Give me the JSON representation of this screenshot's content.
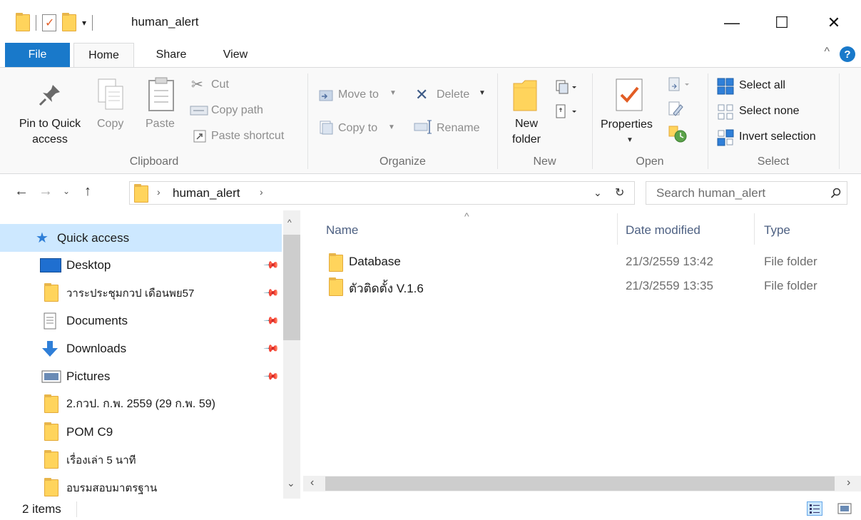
{
  "window": {
    "title": "human_alert",
    "minimize": "—",
    "maximize": "☐",
    "close": "✕"
  },
  "quick_access_toolbar": {
    "customize": "▾"
  },
  "ribbon_tabs": [
    "File",
    "Home",
    "Share",
    "View"
  ],
  "ribbon": {
    "clipboard": {
      "group": "Clipboard",
      "pin_line1": "Pin to Quick",
      "pin_line2": "access",
      "copy": "Copy",
      "paste": "Paste",
      "cut": "Cut",
      "copy_path": "Copy path",
      "paste_shortcut": "Paste shortcut"
    },
    "organize": {
      "group": "Organize",
      "move_to": "Move to",
      "copy_to": "Copy to",
      "delete": "Delete",
      "rename": "Rename"
    },
    "new": {
      "group": "New",
      "new_folder_line1": "New",
      "new_folder_line2": "folder"
    },
    "open": {
      "group": "Open",
      "properties": "Properties"
    },
    "select": {
      "group": "Select",
      "select_all": "Select all",
      "select_none": "Select none",
      "invert_selection": "Invert selection"
    }
  },
  "address": {
    "path_segment": "human_alert",
    "search_placeholder": "Search human_alert"
  },
  "nav_pane": {
    "quick_access": "Quick access",
    "items": [
      {
        "label": "Desktop",
        "icon": "desktop-icon",
        "pinned": true
      },
      {
        "label": "วาระประชุมกวป เดือนพย57",
        "icon": "folder-icon",
        "pinned": true
      },
      {
        "label": "Documents",
        "icon": "documents-icon",
        "pinned": true
      },
      {
        "label": "Downloads",
        "icon": "downloads-icon",
        "pinned": true
      },
      {
        "label": "Pictures",
        "icon": "pictures-icon",
        "pinned": true
      },
      {
        "label": "2.กวป. ก.พ. 2559 (29 ก.พ. 59)",
        "icon": "folder-icon",
        "pinned": false
      },
      {
        "label": "POM C9",
        "icon": "folder-icon",
        "pinned": false
      },
      {
        "label": "เรื่องเล่า 5 นาที",
        "icon": "folder-icon",
        "pinned": false
      },
      {
        "label": "อบรมสอบมาตรฐาน",
        "icon": "folder-icon",
        "pinned": false
      }
    ]
  },
  "file_list": {
    "columns": {
      "name": "Name",
      "date": "Date modified",
      "type": "Type"
    },
    "rows": [
      {
        "name": "Database",
        "date": "21/3/2559 13:42",
        "type": "File folder"
      },
      {
        "name": "ตัวติดตั้ง V.1.6",
        "date": "21/3/2559 13:35",
        "type": "File folder"
      }
    ]
  },
  "status": {
    "item_count": "2 items"
  },
  "colors": {
    "accent": "#1979ca",
    "selection": "#cde8ff",
    "folder": "#ffd45c",
    "cut_red": "#e25d25"
  }
}
